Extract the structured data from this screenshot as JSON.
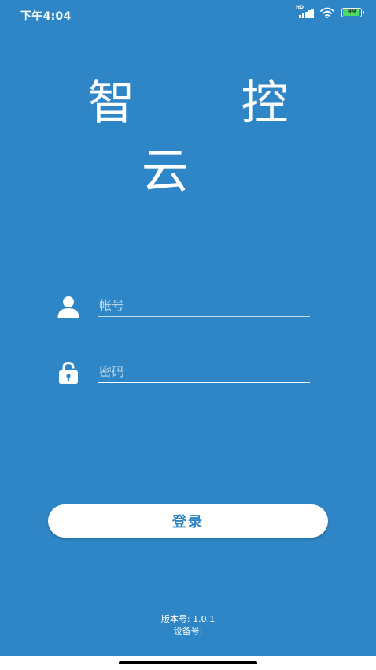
{
  "status_bar": {
    "time": "下午4:04",
    "network_label": "HD",
    "battery_level": "99",
    "battery_fraction": 0.99,
    "icons": [
      "signal-icon",
      "wifi-icon",
      "battery-icon"
    ]
  },
  "app": {
    "title": "智 控 云"
  },
  "form": {
    "account_placeholder": "帐号",
    "password_placeholder": "密码",
    "account_value": "",
    "password_value": "",
    "icons": [
      "user-icon",
      "unlocked-padlock-icon"
    ]
  },
  "login_button": {
    "label": "登录"
  },
  "footer": {
    "version_label": "版本号",
    "version_value": "1.0.1",
    "device_label": "设备号",
    "device_value": ""
  },
  "colors": {
    "background": "#2f86c6",
    "button_text": "#2f86c6",
    "battery_fill": "#4cd964"
  }
}
